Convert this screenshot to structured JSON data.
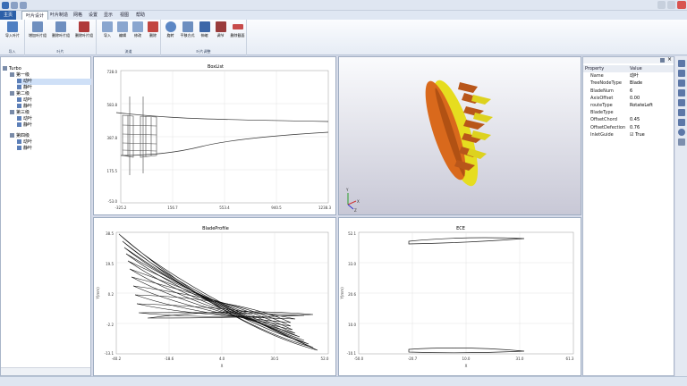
{
  "menu": {
    "tabs": [
      "主页",
      "叶片设计",
      "叶片制造",
      "网格",
      "设置",
      "显示",
      "视图",
      "帮助"
    ],
    "active_index": 1
  },
  "ribbon": {
    "groups": [
      {
        "name": "导入",
        "buttons": [
          "导入叶片"
        ]
      },
      {
        "name": "叶片",
        "buttons": [
          "增加叶片组",
          "删除叶片组",
          "删除叶片组"
        ]
      },
      {
        "name": "流道",
        "buttons": [
          "导入",
          "编辑",
          "修改",
          "删除"
        ]
      },
      {
        "name": "叶片调整",
        "buttons": [
          "旋转",
          "平移方式",
          "伸缩",
          "调节",
          "删除截面"
        ]
      }
    ]
  },
  "tree": {
    "root": "Turbo",
    "stages": [
      {
        "label": "第一级",
        "children": [
          "动叶",
          "静叶"
        ]
      },
      {
        "label": "第二级",
        "children": [
          "动叶",
          "静叶"
        ]
      },
      {
        "label": "第三级",
        "children": [
          "动叶",
          "静叶"
        ]
      },
      {
        "label": "第四级",
        "children": [
          "动叶",
          "静叶"
        ]
      }
    ]
  },
  "panes": {
    "meridional": {
      "title": "BoxList",
      "x_ticks": [
        "-325.2",
        "156.7",
        "553.4",
        "940.5",
        "1238.3"
      ],
      "y_ticks": [
        "728.0",
        "583.8",
        "387.8",
        "175.5",
        "-53.0"
      ]
    },
    "view3d": {
      "axis_labels": [
        "X",
        "Y",
        "Z"
      ]
    },
    "profile": {
      "title": "BladeProfile",
      "x_ticks": [
        "-40.2",
        "-18.6",
        "4.0",
        "30.5",
        "52.0"
      ],
      "y_ticks": [
        "38.5",
        "19.5",
        "0.2",
        "-2.2",
        "-13.1"
      ],
      "xlabel": "X",
      "ylabel": "Y(mm)"
    },
    "section": {
      "title": "ECE",
      "x_ticks": [
        "-50.0",
        "-20.7",
        "10.0",
        "31.0",
        "61.3"
      ],
      "y_ticks": [
        "52.1",
        "33.0",
        "20.6",
        "10.0",
        "-10.1"
      ],
      "xlabel": "X",
      "ylabel": "Y(mm)"
    }
  },
  "properties": {
    "header": [
      "Property",
      "Value"
    ],
    "rows": [
      [
        "Name",
        "动叶"
      ],
      [
        "TreeNodeType",
        "Blade"
      ],
      [
        "BladeNum",
        "6"
      ],
      [
        "AxisOffset",
        "0.00"
      ],
      [
        "routeType",
        "RotateLeft"
      ],
      [
        "BladeType",
        ""
      ],
      [
        "OffsetChord",
        "0.45"
      ],
      [
        "OffsetDefection",
        "0.76"
      ],
      [
        "InletGuide",
        "☑ True"
      ]
    ]
  },
  "colors": {
    "accent": "#2b5fa8",
    "blade_orange": "#d9691c",
    "blade_yellow": "#e6dd1f"
  }
}
